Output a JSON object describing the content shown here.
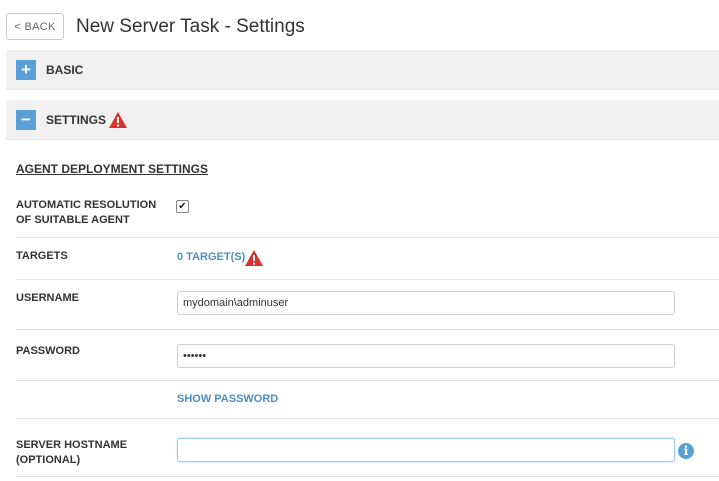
{
  "header": {
    "back_label": "< BACK",
    "title": "New Server Task - Settings"
  },
  "sections": {
    "basic": {
      "toggle": "+",
      "label": "BASIC"
    },
    "settings": {
      "toggle": "−",
      "label": "SETTINGS"
    }
  },
  "agent_deployment": {
    "heading": "AGENT DEPLOYMENT SETTINGS",
    "auto_resolution": {
      "label_line1": "AUTOMATIC RESOLUTION",
      "label_line2": "OF SUITABLE AGENT",
      "checked": true,
      "check_glyph": "✔"
    },
    "targets": {
      "label": "TARGETS",
      "link": "0 TARGET(S)"
    },
    "username": {
      "label": "USERNAME",
      "value": "mydomain\\adminuser"
    },
    "password": {
      "label": "PASSWORD",
      "value": "••••••",
      "show_link": "SHOW PASSWORD"
    },
    "hostname": {
      "label_line1": "SERVER HOSTNAME",
      "label_line2": "(OPTIONAL)",
      "value": ""
    }
  },
  "colors": {
    "accent": "#5aa0d6",
    "link": "#4a8fc4",
    "warning": "#d9332b",
    "bar_bg": "#f1f1f1"
  },
  "icons": {
    "warning": "warning-triangle-icon",
    "info": "info-icon"
  }
}
